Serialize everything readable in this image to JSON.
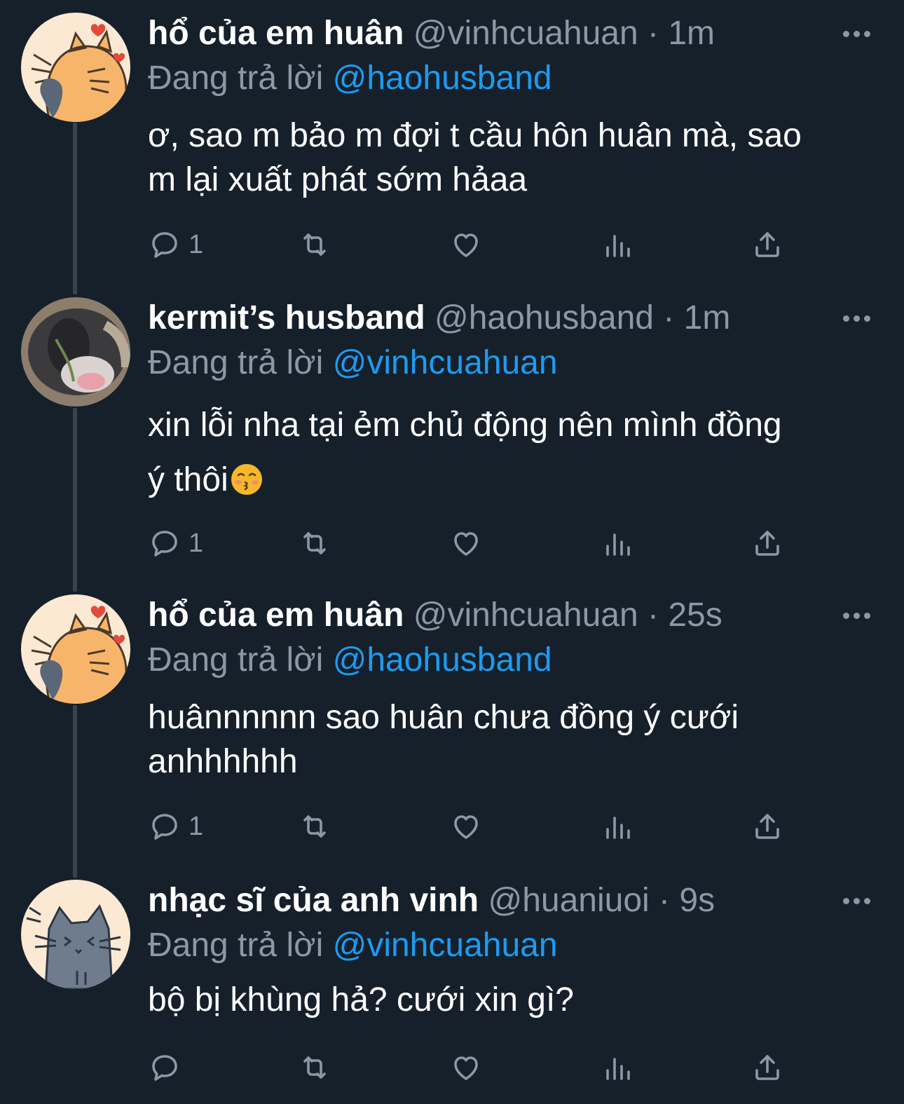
{
  "tweets": [
    {
      "name": "hổ của em huân",
      "handle": "@vinhcuahuan",
      "time": "1m",
      "reply_label": "Đang trả lời",
      "reply_to": "@haohusband",
      "text_lines": [
        "ơ, sao m bảo m đợi t cầu hôn huân mà, sao",
        "m lại xuất phát sớm hảaa"
      ],
      "reply_count": "1",
      "avatar": "tiger-cat-avatar"
    },
    {
      "name": "kermit’s husband",
      "handle": "@haohusband",
      "time": "1m",
      "reply_label": "Đang trả lời",
      "reply_to": "@vinhcuahuan",
      "text_lines": [
        "xin lỗi nha tại ẻm chủ động nên mình đồng",
        "ý thôi"
      ],
      "reply_count": "1",
      "avatar": "blurry-cat-photo-avatar",
      "emoji": "kissing-face-emoji"
    },
    {
      "name": "hổ của em huân",
      "handle": "@vinhcuahuan",
      "time": "25s",
      "reply_label": "Đang trả lời",
      "reply_to": "@haohusband",
      "text_lines": [
        "huânnnnnn sao huân chưa đồng ý cưới",
        "anhhhhhh"
      ],
      "reply_count": "1",
      "avatar": "tiger-cat-avatar"
    },
    {
      "name": "nhạc sĩ của anh vinh",
      "handle": "@huaniuoi",
      "time": "9s",
      "reply_label": "Đang trả lời",
      "reply_to": "@vinhcuahuan",
      "text_lines": [
        "bộ bị khùng hả? cưới xin gì?"
      ],
      "reply_count": "",
      "avatar": "gray-cat-avatar"
    }
  ],
  "separator": "·",
  "icons": [
    "reply-icon",
    "retweet-icon",
    "like-icon",
    "views-icon",
    "share-icon",
    "more-icon"
  ],
  "colors": {
    "background": "#15202b",
    "muted": "#8b98a5",
    "link": "#1d9bf0",
    "thread_line": "#38444d"
  }
}
